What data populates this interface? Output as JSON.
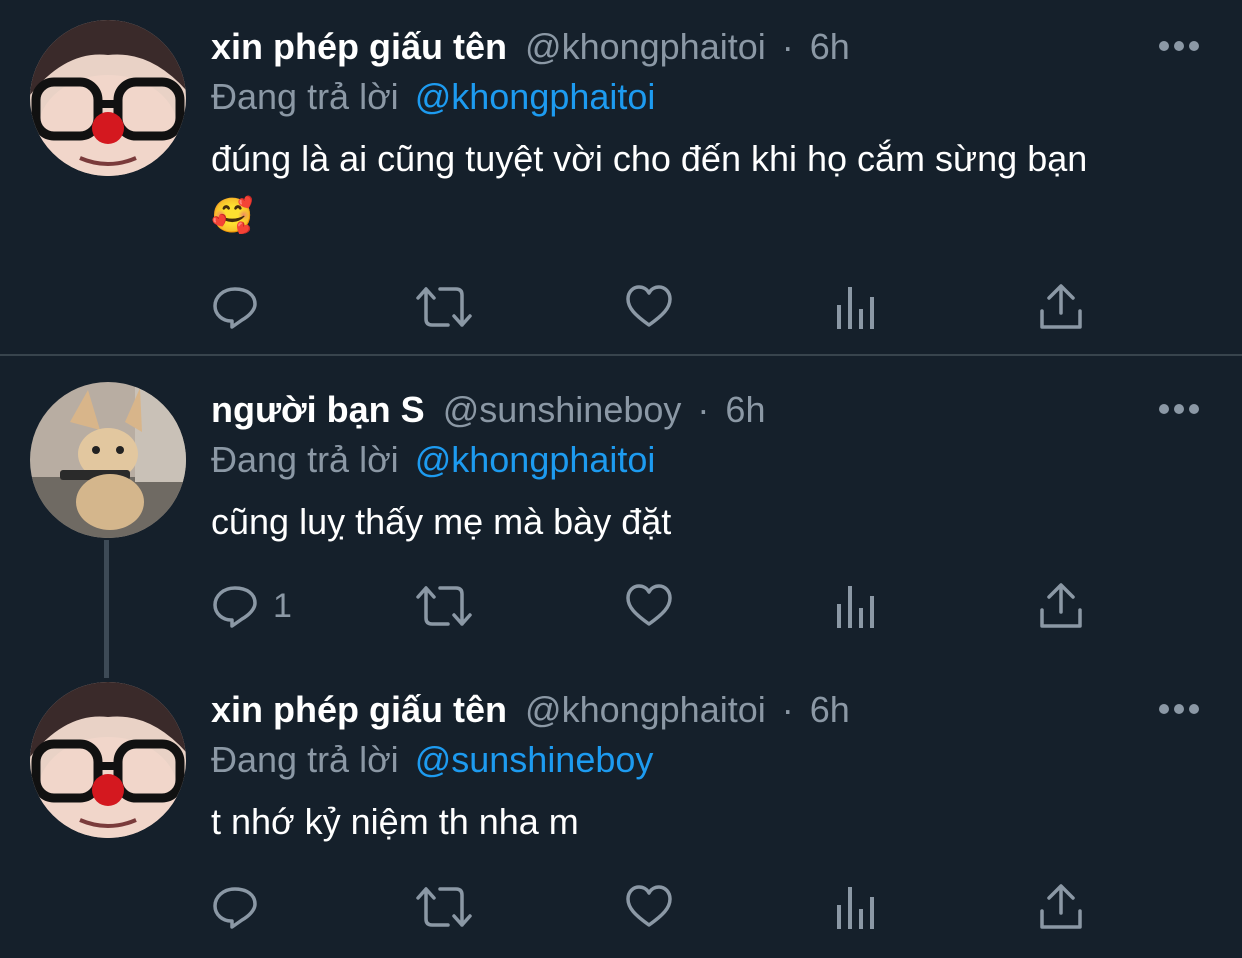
{
  "colors": {
    "background": "#15202b",
    "secondary_text": "#8b98a5",
    "mention": "#1d9bf0",
    "divider": "#38444d"
  },
  "icons": {
    "reply": "reply-icon",
    "retweet": "retweet-icon",
    "like": "heart-icon",
    "analytics": "analytics-icon",
    "share": "share-icon",
    "more": "more-icon"
  },
  "tweets": [
    {
      "name": "xin phép giấu tên",
      "handle": "@khongphaitoi",
      "separator": "·",
      "time": "6h",
      "reply_prefix": "Đang trả lời",
      "reply_to": "@khongphaitoi",
      "text": "đúng là ai cũng tuyệt vời cho đến khi họ cắm sừng bạn",
      "emoji": "🥰",
      "reply_count": ""
    },
    {
      "name": "người bạn S",
      "handle": "@sunshineboy",
      "separator": "·",
      "time": "6h",
      "reply_prefix": "Đang trả lời",
      "reply_to": "@khongphaitoi",
      "text": "cũng luỵ thấy mẹ mà bày đặt",
      "reply_count": "1"
    },
    {
      "name": "xin phép giấu tên",
      "handle": "@khongphaitoi",
      "separator": "·",
      "time": "6h",
      "reply_prefix": "Đang trả lời",
      "reply_to": "@sunshineboy",
      "text": "t nhớ kỷ niệm th nha m",
      "reply_count": ""
    }
  ]
}
